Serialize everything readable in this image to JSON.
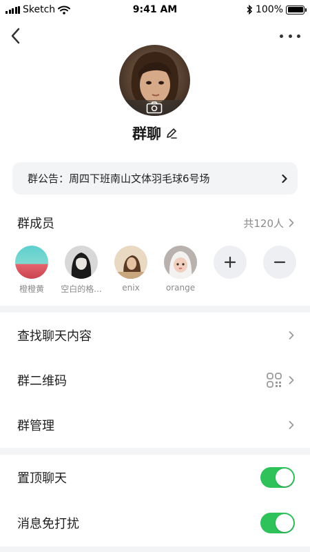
{
  "status_bar": {
    "carrier": "Sketch",
    "time": "9:41 AM",
    "battery": "100%"
  },
  "group": {
    "name": "群聊"
  },
  "notice": {
    "text": "群公告：周四下班南山文体羽毛球6号场"
  },
  "members": {
    "title": "群成员",
    "count_label": "共120人",
    "list": [
      {
        "name": "橙橙黄"
      },
      {
        "name": "空白的格..."
      },
      {
        "name": "enix"
      },
      {
        "name": "orange"
      }
    ]
  },
  "menu": {
    "search_history": "查找聊天内容",
    "qr_code": "群二维码",
    "manage": "群管理"
  },
  "settings": {
    "pin_chat": "置顶聊天",
    "pin_chat_on": true,
    "mute": "消息免打扰",
    "mute_on": true
  },
  "colors": {
    "accent": "#2fc25b",
    "band": "#f3f4f6",
    "muted_text": "#8a8a8a"
  }
}
